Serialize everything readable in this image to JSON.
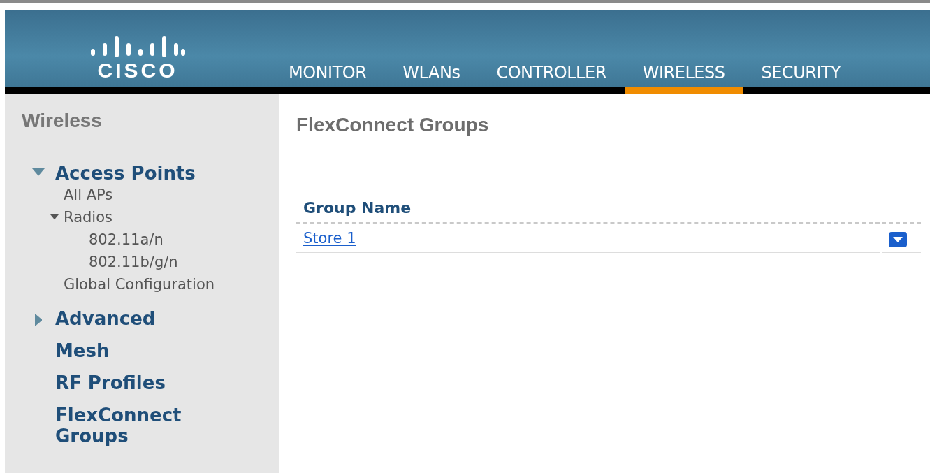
{
  "header": {
    "logo": "CISCO",
    "nav": [
      {
        "label": "MONITOR",
        "selected": false
      },
      {
        "label": "WLANs",
        "selected": false
      },
      {
        "label": "CONTROLLER",
        "selected": false
      },
      {
        "label": "WIRELESS",
        "selected": true
      },
      {
        "label": "SECURITY",
        "selected": false
      }
    ]
  },
  "sidebar": {
    "title": "Wireless",
    "items": [
      {
        "label": "Access Points",
        "expanded": true,
        "children": [
          {
            "label": "All APs"
          },
          {
            "label": "Radios",
            "expanded": true,
            "children": [
              {
                "label": "802.11a/n"
              },
              {
                "label": "802.11b/g/n"
              }
            ]
          },
          {
            "label": "Global Configuration"
          }
        ]
      },
      {
        "label": "Advanced",
        "expanded": false
      },
      {
        "label": "Mesh"
      },
      {
        "label": "RF Profiles"
      },
      {
        "label": "FlexConnect Groups"
      }
    ]
  },
  "main": {
    "title": "FlexConnect Groups",
    "table": {
      "columns": [
        "Group Name"
      ],
      "rows": [
        {
          "group_name": "Store 1"
        }
      ]
    }
  }
}
